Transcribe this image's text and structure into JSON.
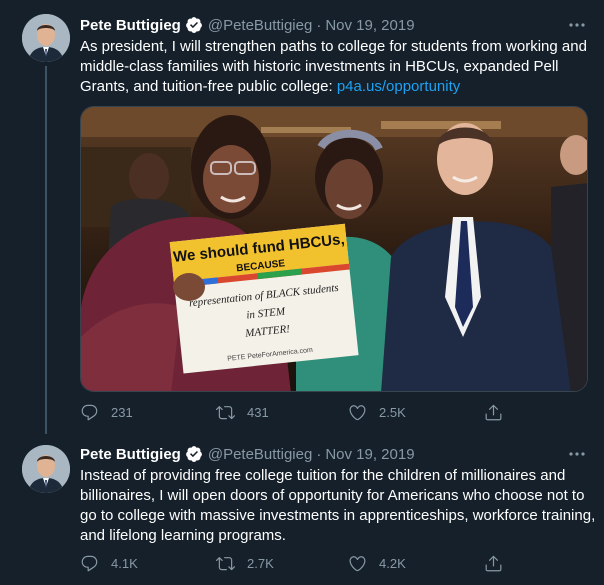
{
  "tweets": [
    {
      "author_name": "Pete Buttigieg",
      "handle": "@PeteButtigieg",
      "separator": "·",
      "date": "Nov 19, 2019",
      "text": "As president, I will strengthen paths to college for students from working and middle-class families with historic investments in HBCUs, expanded Pell Grants, and tuition-free public college:",
      "link": "p4a.us/opportunity",
      "media": {
        "sign_line1": "We should fund HBCUs,",
        "sign_line2": "BECAUSE",
        "sign_handwriting": [
          "representation of BLACK students",
          "in STEM",
          "MATTER!"
        ],
        "sign_footer": "PETE  PeteForAmerica.com"
      },
      "replies": "231",
      "retweets": "431",
      "likes": "2.5K"
    },
    {
      "author_name": "Pete Buttigieg",
      "handle": "@PeteButtigieg",
      "separator": "·",
      "date": "Nov 19, 2019",
      "text": "Instead of providing free college tuition for the children of millionaires and billionaires, I will open doors of opportunity for Americans who choose not to go to college with massive investments in apprenticeships, workforce training, and lifelong learning programs.",
      "replies": "4.1K",
      "retweets": "2.7K",
      "likes": "4.2K"
    }
  ],
  "colors": {
    "background": "#15202b",
    "text": "#ffffff",
    "muted": "#8899a6",
    "link": "#1da1f2",
    "verified": "#ffffff",
    "thread_line": "#3d5466"
  }
}
